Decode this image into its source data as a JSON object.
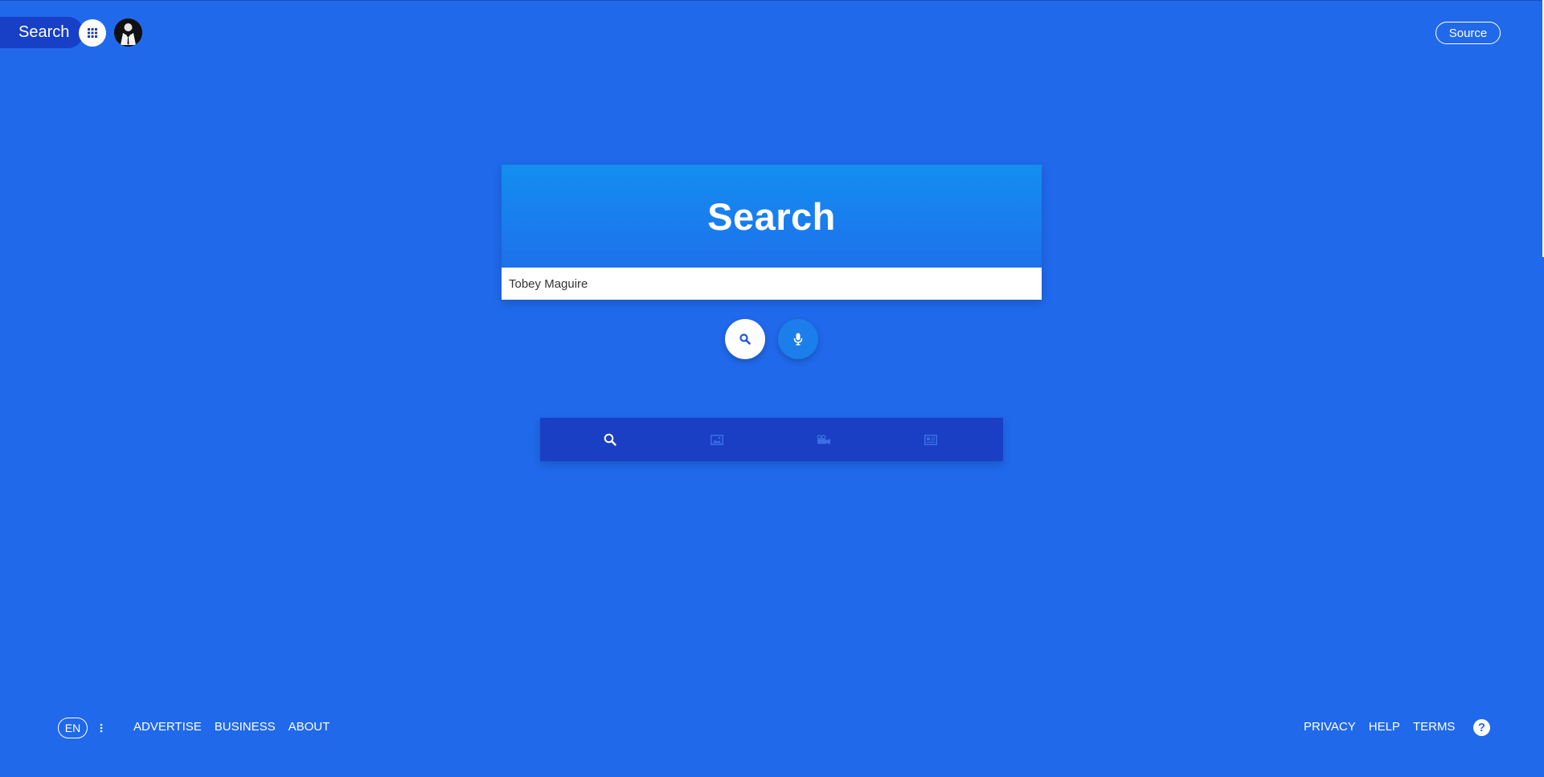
{
  "header": {
    "brand_label": "Search",
    "apps_icon": "grid-icon",
    "avatar_icon": "tuxedo-avatar",
    "source_label": "Source"
  },
  "search": {
    "title": "Search",
    "query": "Tobey Maguire",
    "submit_icon": "search-icon",
    "voice_icon": "microphone-icon"
  },
  "categories": [
    {
      "id": "web",
      "icon": "search-icon",
      "active": true
    },
    {
      "id": "images",
      "icon": "image-icon",
      "active": false
    },
    {
      "id": "videos",
      "icon": "video-camera-icon",
      "active": false
    },
    {
      "id": "news",
      "icon": "newspaper-icon",
      "active": false
    }
  ],
  "footer": {
    "language": "EN",
    "more_icon": "vertical-dots-icon",
    "left_links": [
      "ADVERTISE",
      "BUSINESS",
      "ABOUT"
    ],
    "right_links": [
      "PRIVACY",
      "HELP",
      "TERMS"
    ],
    "help_icon_glyph": "?"
  },
  "colors": {
    "background": "#2069eb",
    "brand_tab": "#1740c7",
    "header_gradient_top": "#138ef0",
    "header_gradient_bottom": "#1e70ec",
    "category_bar": "#1a3fc4",
    "inactive_icon": "#3a6fe6"
  }
}
